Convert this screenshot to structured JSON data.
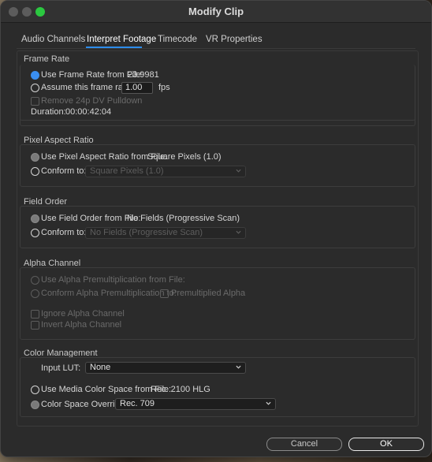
{
  "window": {
    "title": "Modify Clip"
  },
  "tabs": [
    "Audio Channels",
    "Interpret Footage",
    "Timecode",
    "VR Properties"
  ],
  "active_tab": "Interpret Footage",
  "frame_rate": {
    "heading": "Frame Rate",
    "use_from_file_label": "Use Frame Rate from File:",
    "use_from_file_value": "23.9981",
    "assume_label": "Assume this frame rate:",
    "assume_value": "1.00",
    "assume_unit": "fps",
    "remove_pulldown_label": "Remove 24p DV Pulldown",
    "duration_label": "Duration:",
    "duration_value": "00:00:42:04"
  },
  "pixel_aspect": {
    "heading": "Pixel Aspect Ratio",
    "use_from_file_label": "Use Pixel Aspect Ratio from File:",
    "use_from_file_value": "Square Pixels (1.0)",
    "conform_label": "Conform to:",
    "conform_value": "Square Pixels (1.0)"
  },
  "field_order": {
    "heading": "Field Order",
    "use_from_file_label": "Use Field Order from File:",
    "use_from_file_value": "No Fields (Progressive Scan)",
    "conform_label": "Conform to:",
    "conform_value": "No Fields (Progressive Scan)"
  },
  "alpha": {
    "heading": "Alpha Channel",
    "use_premult_label": "Use Alpha Premultiplication from File:",
    "conform_premult_label": "Conform Alpha Premultiplication to:",
    "premultiplied_label": "Premultiplied Alpha",
    "ignore_label": "Ignore Alpha Channel",
    "invert_label": "Invert Alpha Channel"
  },
  "color": {
    "heading": "Color Management",
    "input_lut_label": "Input LUT:",
    "input_lut_value": "None",
    "use_media_label": "Use Media Color Space from File:",
    "use_media_value": "Rec. 2100 HLG",
    "override_label": "Color Space Override:",
    "override_value": "Rec. 709"
  },
  "buttons": {
    "cancel": "Cancel",
    "ok": "OK"
  },
  "colors": {
    "accent": "#3a8ef0",
    "background": "#2b2b2b",
    "traffic_green": "#2bc840"
  }
}
